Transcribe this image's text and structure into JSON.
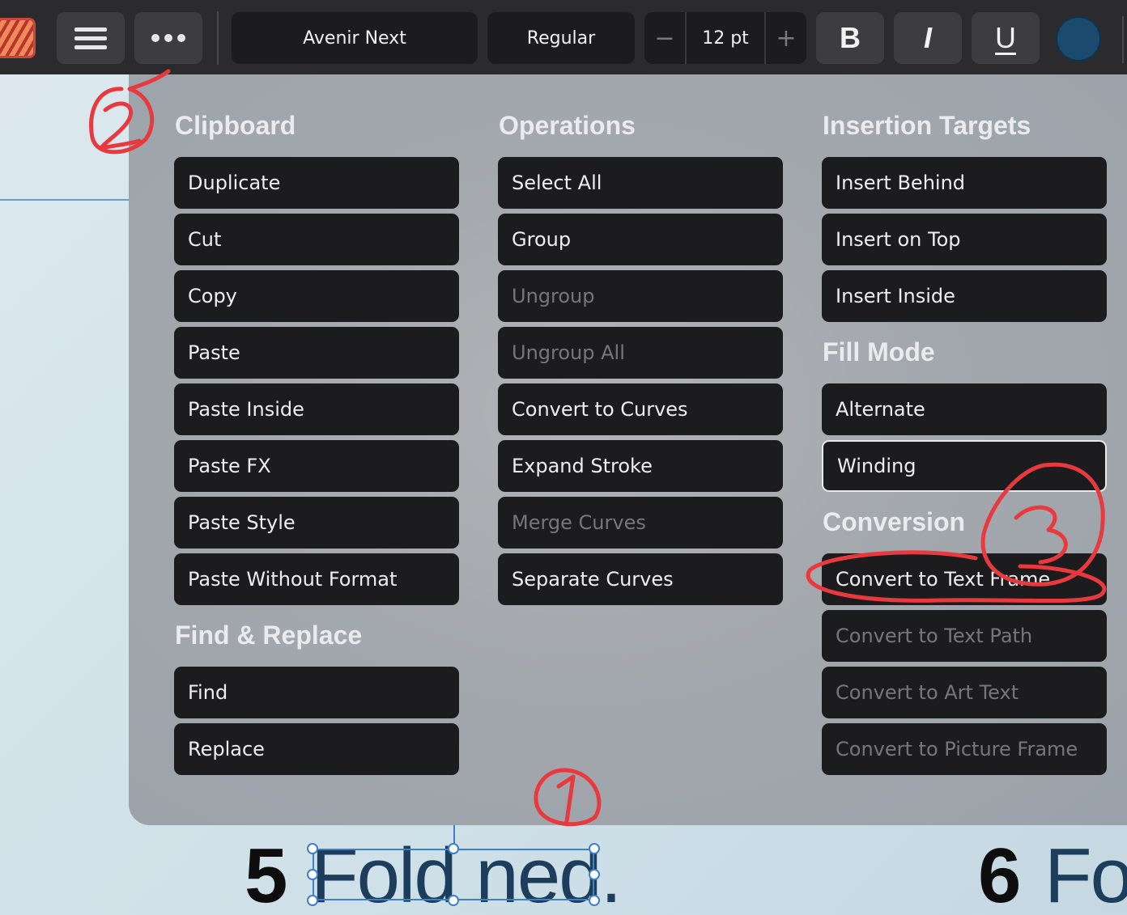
{
  "toolbar": {
    "font_family": "Avenir Next",
    "font_style": "Regular",
    "font_size": "12 pt",
    "decrease_glyph": "−",
    "increase_glyph": "+",
    "bold_glyph": "B",
    "italic_glyph": "I",
    "underline_glyph": "U",
    "color_value": "#1a4a6e",
    "icons": [
      "app-icon",
      "hamburger-menu-icon",
      "more-options-icon"
    ]
  },
  "menu": {
    "clipboard": {
      "title": "Clipboard",
      "items": [
        "Duplicate",
        "Cut",
        "Copy",
        "Paste",
        "Paste Inside",
        "Paste FX",
        "Paste Style",
        "Paste Without Format"
      ]
    },
    "find_replace": {
      "title": "Find & Replace",
      "items": [
        "Find",
        "Replace"
      ]
    },
    "operations": {
      "title": "Operations",
      "items": [
        "Select All",
        "Group",
        "Ungroup",
        "Ungroup All",
        "Convert to Curves",
        "Expand Stroke",
        "Merge Curves",
        "Separate Curves"
      ],
      "disabled": [
        "Ungroup",
        "Ungroup All",
        "Merge Curves"
      ]
    },
    "insertion_targets": {
      "title": "Insertion Targets",
      "items": [
        "Insert Behind",
        "Insert on Top",
        "Insert Inside"
      ]
    },
    "fill_mode": {
      "title": "Fill Mode",
      "items": [
        "Alternate",
        "Winding"
      ],
      "selected": "Winding"
    },
    "conversion": {
      "title": "Conversion",
      "items": [
        "Convert to Text Frame",
        "Convert to Text Path",
        "Convert to Art Text",
        "Convert to Picture Frame"
      ],
      "disabled": [
        "Convert to Text Path",
        "Convert to Art Text",
        "Convert to Picture Frame"
      ]
    }
  },
  "canvas": {
    "page_num_5": "5",
    "heading_5": "Fold ned.",
    "page_num_6": "6",
    "heading_6": "Fol"
  },
  "annotations": {
    "color": "#e8393f",
    "labels": [
      "1",
      "2",
      "3"
    ]
  }
}
